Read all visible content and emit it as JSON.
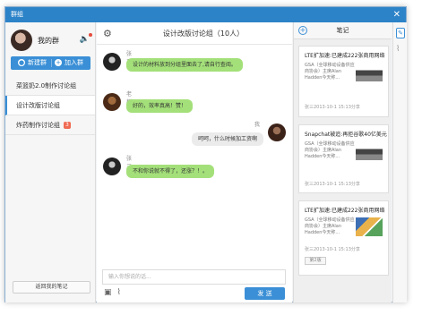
{
  "window": {
    "title": "群组",
    "close_glyph": "✕"
  },
  "user": {
    "name": "我的群"
  },
  "actions": {
    "new_group": "新建群",
    "join_group": "加入群"
  },
  "groups": [
    {
      "name": "菜篮奶2.0制作讨论组",
      "badge": ""
    },
    {
      "name": "设计改版讨论组",
      "badge": ""
    },
    {
      "name": "炸药制作讨论组",
      "badge": "3"
    }
  ],
  "left_footer": {
    "back_label": "返回我的笔记"
  },
  "chat": {
    "title": "设计改版讨论组（10人）",
    "messages": [
      {
        "sender": "张三",
        "text": "设计的材料放到分组里面去了,请自行查阅。"
      },
      {
        "sender": "老板",
        "text": "好的，效率真高！赞！"
      },
      {
        "sender": "我",
        "text": "呵呵，什么时候加工资啊"
      },
      {
        "sender": "张三",
        "text": "不和你说就不得了，还涨？！。"
      }
    ],
    "input_placeholder": "输入你想说的话...",
    "send_label": "发 送"
  },
  "notes": {
    "title": "笔记",
    "cards": [
      {
        "title": "LTE扩加速:已建成222张商用网络",
        "body": "GSA（全球移动设备供应商协会）主席Alan Hadden今天称...",
        "meta": "张三2013-10-1 15:13分享",
        "tag": ""
      },
      {
        "title": "Snapchat被追:再拒谷歌40亿美元",
        "body": "GSA（全球移动设备供应商协会）主席Alan Hadden今天称...",
        "meta": "张三2013-10-1 15:13分享",
        "tag": ""
      },
      {
        "title": "LTE扩加速:已建成222张商用网络",
        "body": "GSA（全球移动设备供应商协会）主席Alan Hadden今天称...",
        "meta": "张三2013-10-1 15:13分享",
        "tag": "第2版"
      }
    ]
  }
}
